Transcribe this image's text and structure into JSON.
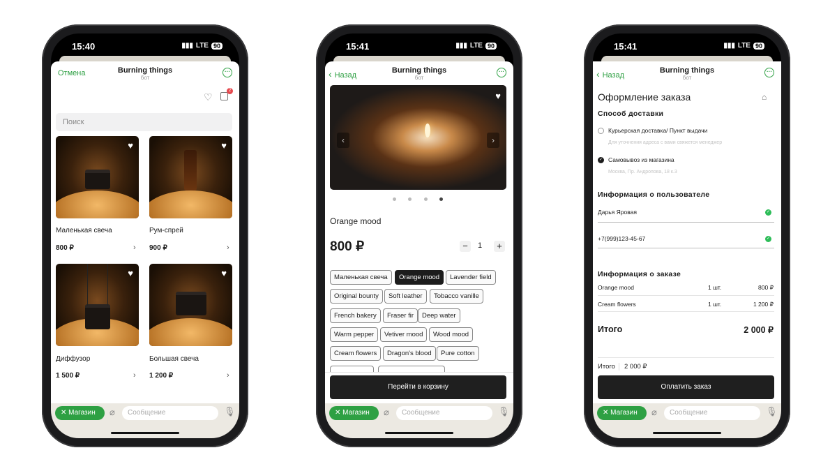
{
  "status": [
    {
      "time": "15:40",
      "network": "LTE",
      "battery": "90"
    },
    {
      "time": "15:41",
      "network": "LTE",
      "battery": "90"
    },
    {
      "time": "15:41",
      "network": "LTE",
      "battery": "90"
    }
  ],
  "header": {
    "title": "Burning things",
    "subtitle": "бот",
    "cancel": "Отмена",
    "back": "Назад"
  },
  "bottom": {
    "shop": "Магазин",
    "message_placeholder": "Сообщение"
  },
  "catalog": {
    "search_placeholder": "Поиск",
    "cart_count": "2",
    "products": [
      {
        "name": "Маленькая свеча",
        "price": "800 ₽"
      },
      {
        "name": "Рум-спрей",
        "price": "900 ₽"
      },
      {
        "name": "Диффузор",
        "price": "1 500 ₽"
      },
      {
        "name": "Большая свеча",
        "price": "1 200 ₽"
      }
    ]
  },
  "product": {
    "name": "Orange mood",
    "price": "800 ₽",
    "quantity": "1",
    "slides": 4,
    "active_slide": 4,
    "variants": [
      "Маленькая свеча",
      "Orange mood",
      "Lavender field",
      "Original bounty",
      "Soft leather",
      "Tobacco vanille",
      "French bakery",
      "Fraser fir",
      "Deep water",
      "Warm pepper",
      "Vetiver mood",
      "Wood mood",
      "Cream flowers",
      "Dragon's blood",
      "Pure cotton"
    ],
    "selected_variant": "Orange mood",
    "cart_button": "Перейти в корзину"
  },
  "checkout": {
    "title": "Оформление заказа",
    "delivery_heading": "Способ доставки",
    "delivery_options": [
      {
        "label": "Курьерская доставка/ Пункт выдачи",
        "hint": "Для уточнения адреса с вами свяжется менеджер",
        "selected": false
      },
      {
        "label": "Самовывоз из магазина",
        "hint": "Москва, Пр. Андропова, 18 к.3",
        "selected": true
      }
    ],
    "user_heading": "Информация о пользователе",
    "user_name": "Дарья Яровая",
    "user_phone": "+7(999)123-45-67",
    "order_heading": "Информация о заказе",
    "items": [
      {
        "name": "Orange mood",
        "qty": "1 шт.",
        "price": "800 ₽"
      },
      {
        "name": "Cream flowers",
        "qty": "1 шт.",
        "price": "1 200 ₽"
      }
    ],
    "total_label": "Итого",
    "total": "2 000 ₽",
    "pay_button": "Оплатить заказ"
  },
  "colors": {
    "accent": "#2ea043",
    "dark": "#1f1f1f",
    "badge": "#e5484d"
  }
}
